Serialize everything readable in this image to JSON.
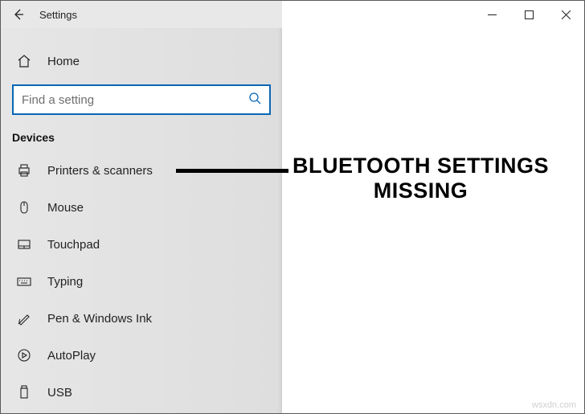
{
  "titlebar": {
    "title": "Settings"
  },
  "sidebar": {
    "home_label": "Home",
    "search_placeholder": "Find a setting",
    "section_label": "Devices",
    "items": [
      {
        "label": "Printers & scanners"
      },
      {
        "label": "Mouse"
      },
      {
        "label": "Touchpad"
      },
      {
        "label": "Typing"
      },
      {
        "label": "Pen & Windows Ink"
      },
      {
        "label": "AutoPlay"
      },
      {
        "label": "USB"
      }
    ]
  },
  "annotation": {
    "line1": "BLUETOOTH SETTINGS",
    "line2": "MISSING"
  },
  "watermark": "wsxdn.com"
}
